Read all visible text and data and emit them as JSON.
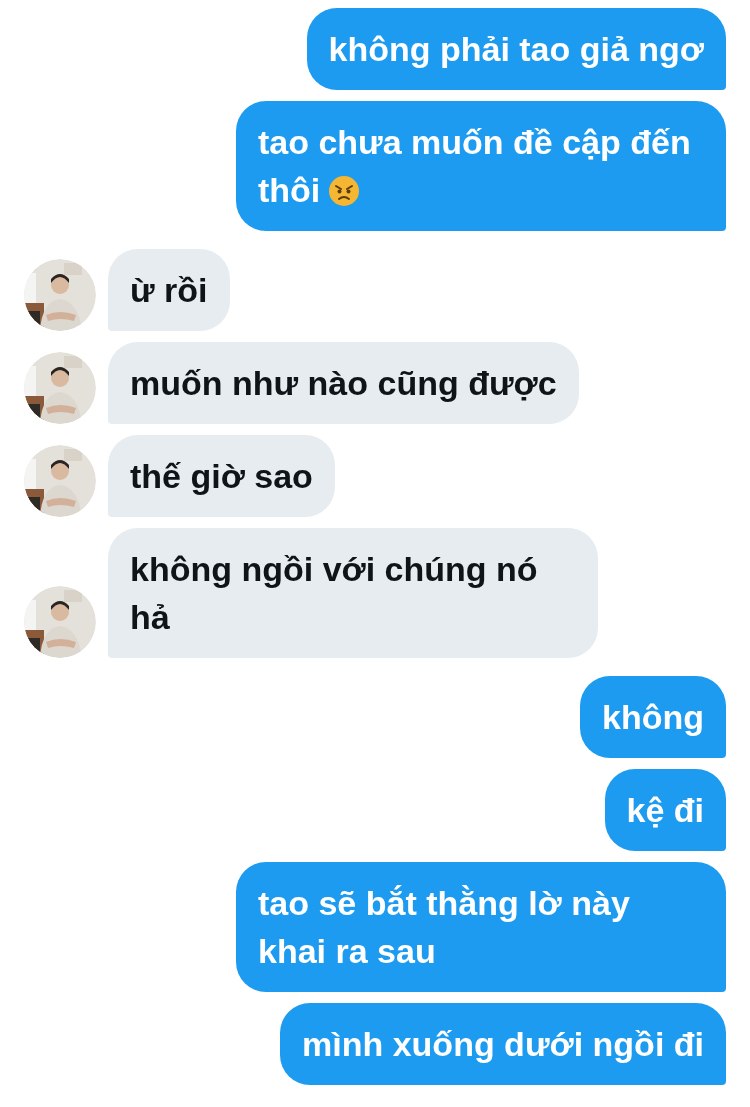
{
  "messages": [
    {
      "outgoing": true,
      "text": "không phải tao giả ngơ"
    },
    {
      "outgoing": true,
      "text": "tao chưa muốn đề cập đến thôi",
      "trailing_icon": true
    },
    {
      "outgoing": false,
      "text": "ừ rồi"
    },
    {
      "outgoing": false,
      "text": "muốn như nào cũng được"
    },
    {
      "outgoing": false,
      "text": "thế giờ sao"
    },
    {
      "outgoing": false,
      "text": "không ngồi với chúng nó hả"
    },
    {
      "outgoing": true,
      "text": "không"
    },
    {
      "outgoing": true,
      "text": "kệ đi"
    },
    {
      "outgoing": true,
      "text": "tao sẽ bắt thằng lờ này khai ra sau"
    },
    {
      "outgoing": true,
      "text": "mình xuống dưới ngồi đi"
    }
  ]
}
